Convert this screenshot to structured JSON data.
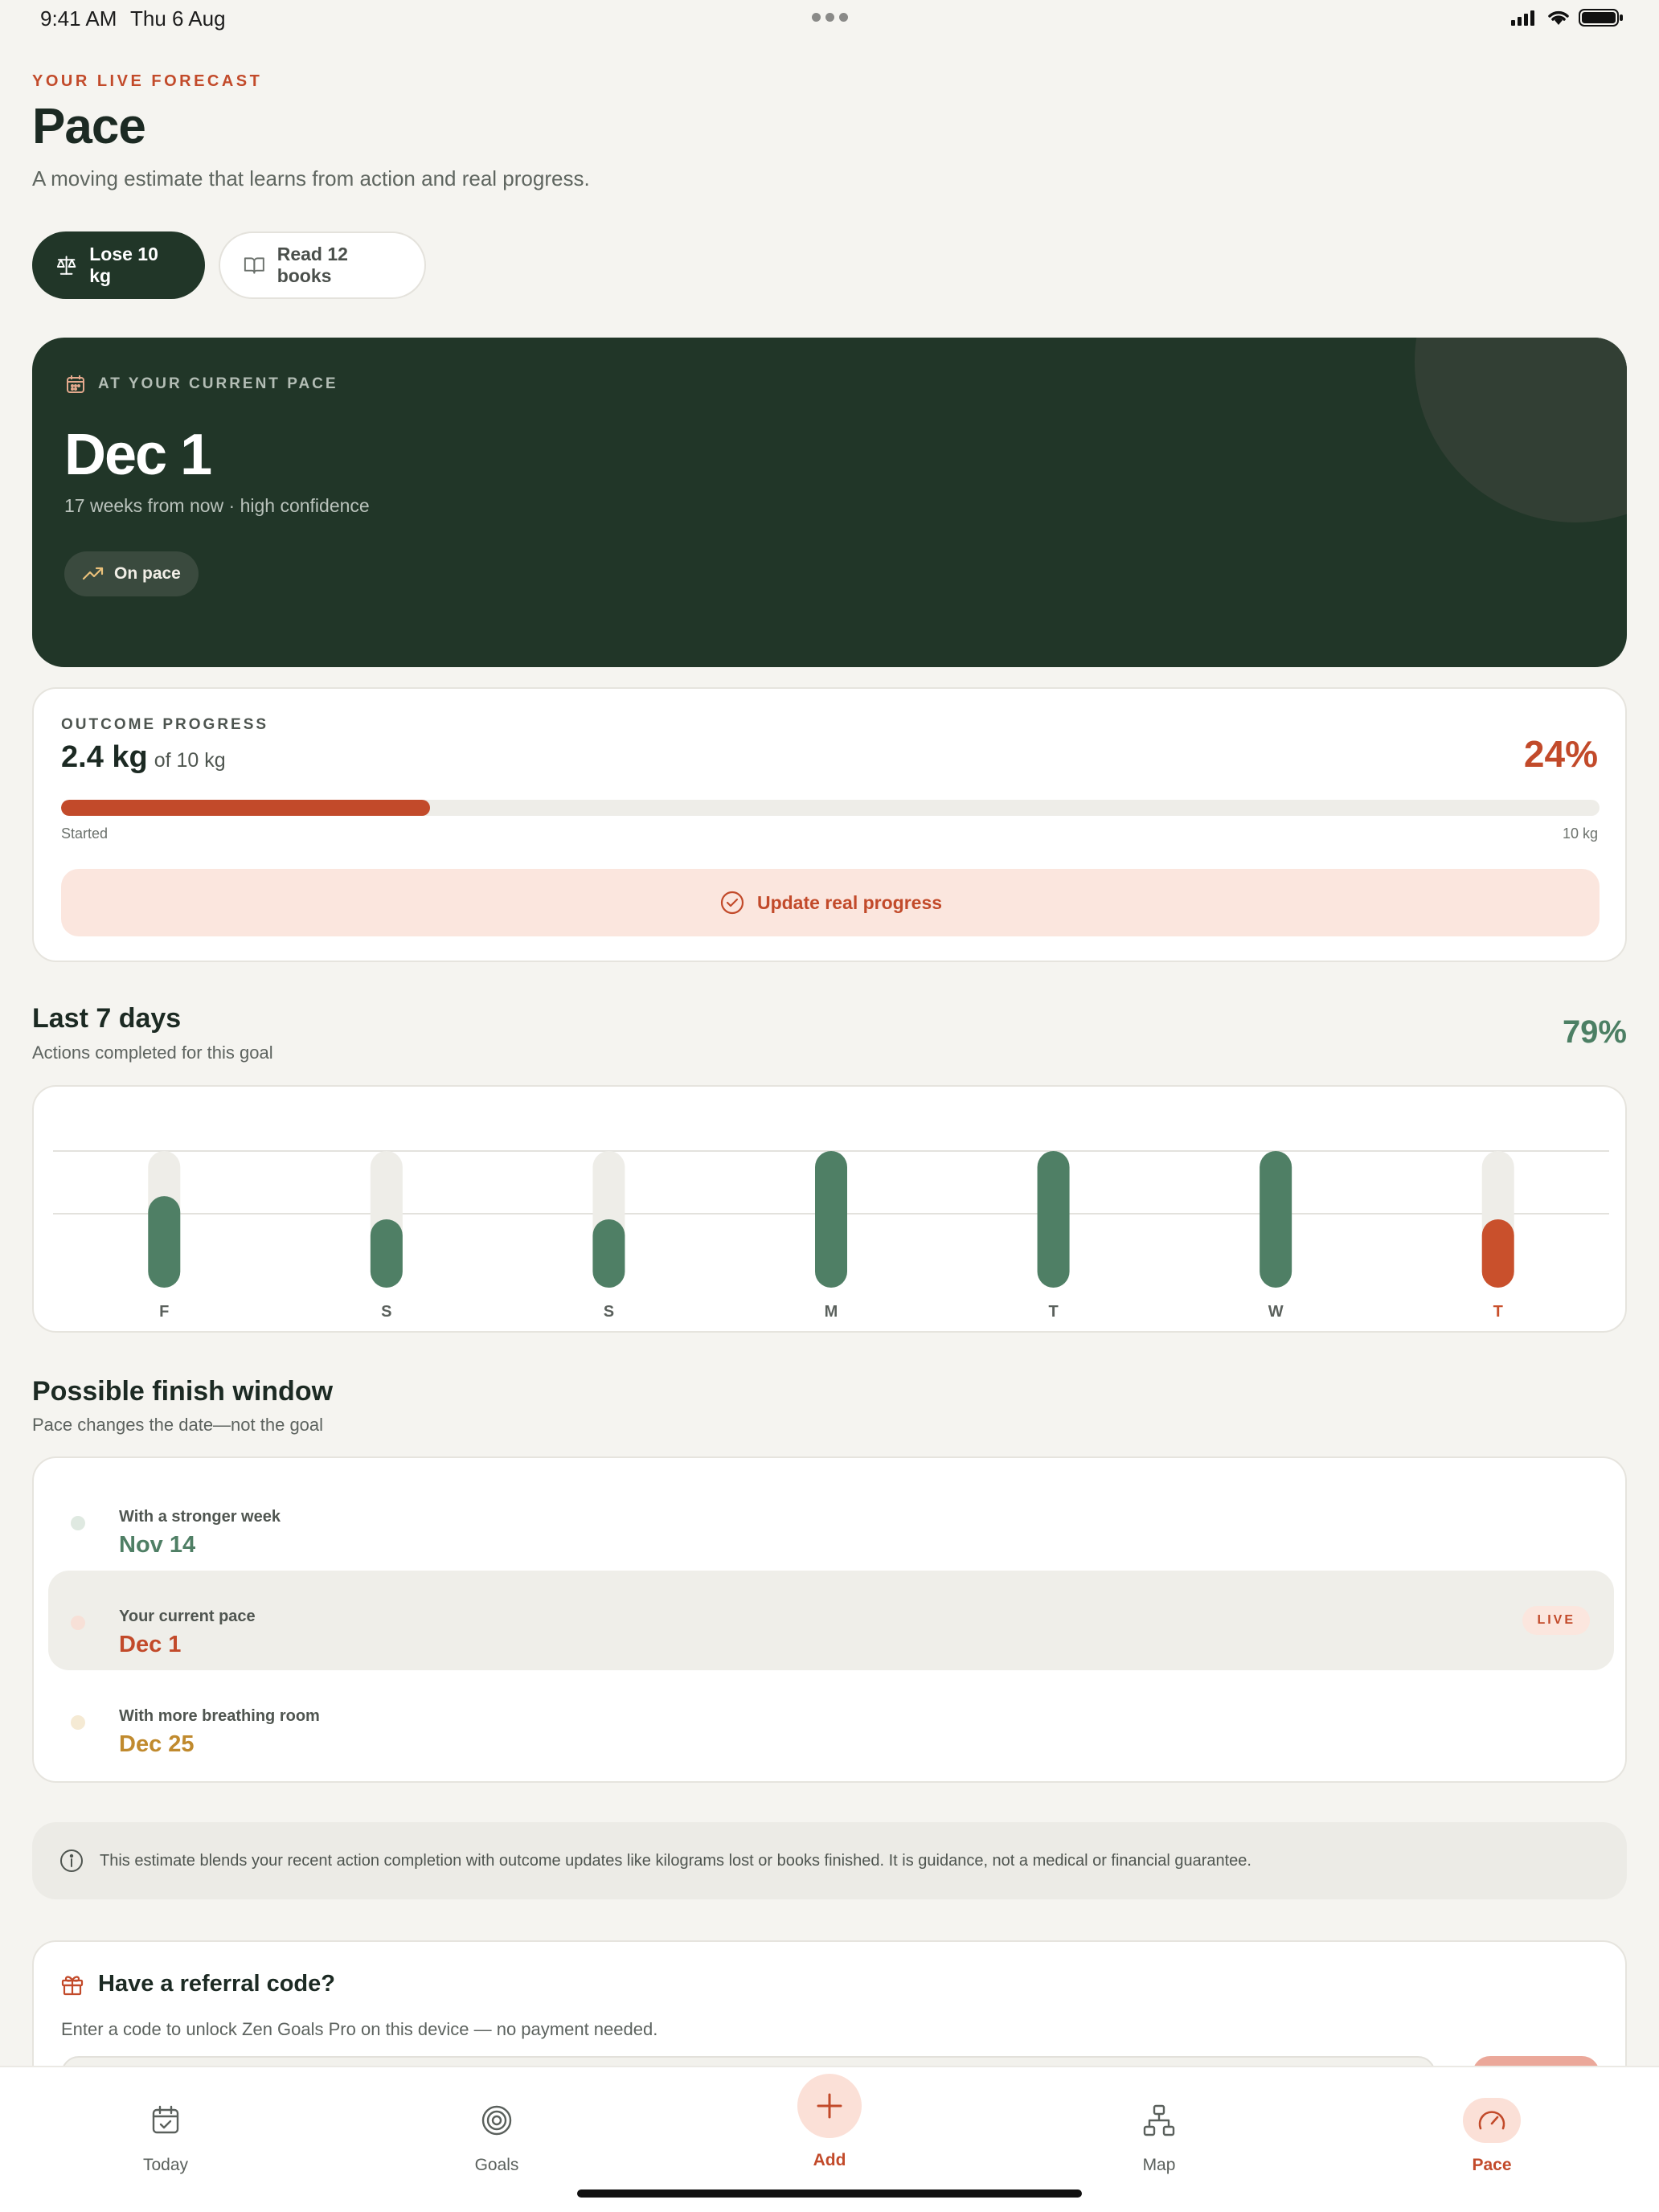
{
  "status_bar": {
    "time": "9:41 AM",
    "date": "Thu 6 Aug"
  },
  "header": {
    "eyebrow": "YOUR LIVE FORECAST",
    "title": "Pace",
    "subtitle": "A moving estimate that learns from action and real progress."
  },
  "goal_tabs": [
    {
      "label": "Lose 10 kg",
      "icon": "scale-icon",
      "active": true
    },
    {
      "label": "Read 12 books",
      "icon": "book-icon",
      "active": false
    }
  ],
  "forecast": {
    "eyebrow": "AT YOUR CURRENT PACE",
    "date": "Dec 1",
    "subtitle": "17 weeks from now · high confidence",
    "status_pill": "On pace"
  },
  "progress": {
    "eyebrow": "OUTCOME PROGRESS",
    "value": "2.4 kg",
    "of_label": "of 10 kg",
    "percent_label": "24%",
    "fraction": 0.24,
    "start_label": "Started",
    "end_label": "10 kg",
    "update_button": "Update real progress"
  },
  "last_7_days": {
    "title": "Last 7 days",
    "subtitle": "Actions completed for this goal",
    "percent": "79%"
  },
  "chart_data": {
    "type": "bar",
    "categories": [
      "F",
      "S",
      "S",
      "M",
      "T",
      "W",
      "T"
    ],
    "values": [
      0.67,
      0.5,
      0.5,
      1.0,
      1.0,
      1.0,
      0.5
    ],
    "ylim": [
      0,
      1
    ],
    "highlight_index": 6,
    "colors": {
      "done": "#4f7f65",
      "today": "#c9502c",
      "track": "#eeede8",
      "grid": "#e3e2dd"
    }
  },
  "finish_window": {
    "title": "Possible finish window",
    "subtitle": "Pace changes the date—not the goal",
    "rows": [
      {
        "label": "With a stronger week",
        "date": "Nov 14",
        "color": "#4f7f65",
        "dot": "#dfe9e1",
        "live": false
      },
      {
        "label": "Your current pace",
        "date": "Dec 1",
        "color": "#c24a2a",
        "dot": "#f7e0d7",
        "live": true,
        "badge": "LIVE"
      },
      {
        "label": "With more breathing room",
        "date": "Dec 25",
        "color": "#c08a2e",
        "dot": "#f5ead4",
        "live": false
      }
    ]
  },
  "note": "This estimate blends your recent action completion with outcome updates like kilograms lost or books finished. It is guidance, not a medical or financial guarantee.",
  "referral": {
    "title": "Have a referral code?",
    "subtitle": "Enter a code to unlock Zen Goals Pro on this device — no payment needed."
  },
  "bottom_nav": {
    "today": "Today",
    "goals": "Goals",
    "add": "Add",
    "map": "Map",
    "pace": "Pace"
  },
  "colors": {
    "accent": "#c24a2a",
    "dark": "#213628",
    "green": "#4f7f65"
  }
}
